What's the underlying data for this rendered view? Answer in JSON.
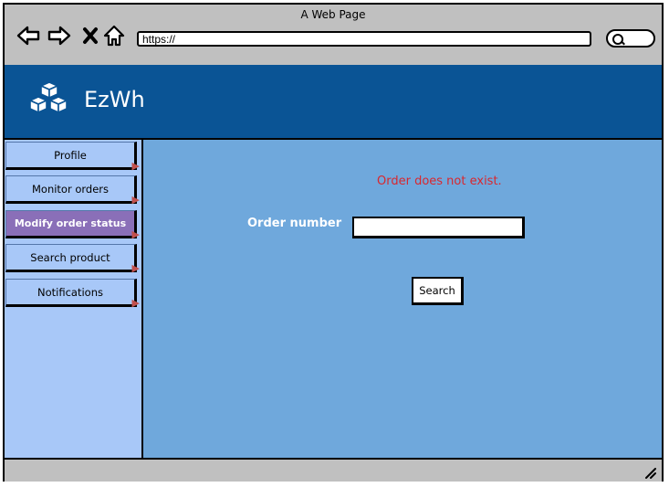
{
  "browser": {
    "title": "A Web Page",
    "url": "https://",
    "icons": {
      "back": "arrow-left-icon",
      "forward": "arrow-right-icon",
      "stop": "close-icon",
      "home": "home-icon",
      "search": "search-icon",
      "resize": "resize-grip-icon"
    }
  },
  "header": {
    "logo": "cubes-logo-icon",
    "brand": "EzWh",
    "background": "#0a5495"
  },
  "sidebar": {
    "items": [
      {
        "label": "Profile",
        "active": false
      },
      {
        "label": "Monitor orders",
        "active": false
      },
      {
        "label": "Modify order status",
        "active": true
      },
      {
        "label": "Search product",
        "active": false
      },
      {
        "label": "Notifications",
        "active": false
      }
    ],
    "active_color": "#8a6fb8"
  },
  "main": {
    "error_message": "Order does not exist.",
    "error_color": "#d9272e",
    "order_label": "Order number",
    "order_value": "",
    "search_button": "Search",
    "background": "#6fa8dc"
  }
}
